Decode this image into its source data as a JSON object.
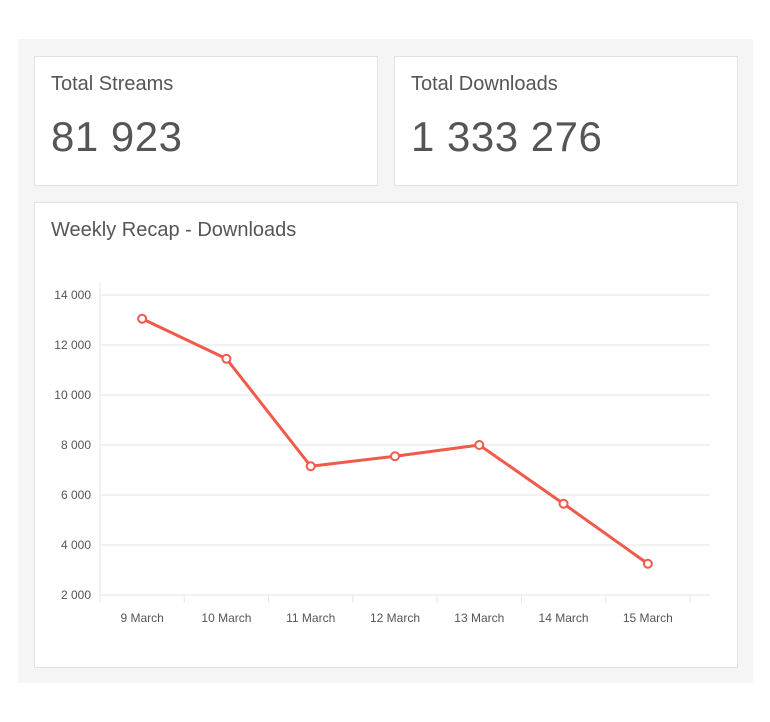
{
  "colors": {
    "line": "#f05a4a",
    "text": "#555555",
    "grid": "#e6e6e6",
    "panel": "#f5f5f5"
  },
  "stats": [
    {
      "title": "Total Streams",
      "value": "81 923"
    },
    {
      "title": "Total Downloads",
      "value": "1 333 276"
    }
  ],
  "chart_title": "Weekly Recap - Downloads",
  "chart_data": {
    "type": "line",
    "title": "Weekly Recap - Downloads",
    "xlabel": "",
    "ylabel": "",
    "categories": [
      "9 March",
      "10 March",
      "11 March",
      "12 March",
      "13 March",
      "14 March",
      "15 March"
    ],
    "series": [
      {
        "values": [
          13050,
          11450,
          7150,
          7550,
          8000,
          5650,
          3250
        ]
      }
    ],
    "ylim": [
      2000,
      14000
    ],
    "yticks": [
      2000,
      4000,
      6000,
      8000,
      10000,
      12000,
      14000
    ],
    "ytick_labels": [
      "2 000",
      "4 000",
      "6 000",
      "8 000",
      "10 000",
      "12 000",
      "14 000"
    ],
    "grid": true,
    "legend": "none"
  }
}
